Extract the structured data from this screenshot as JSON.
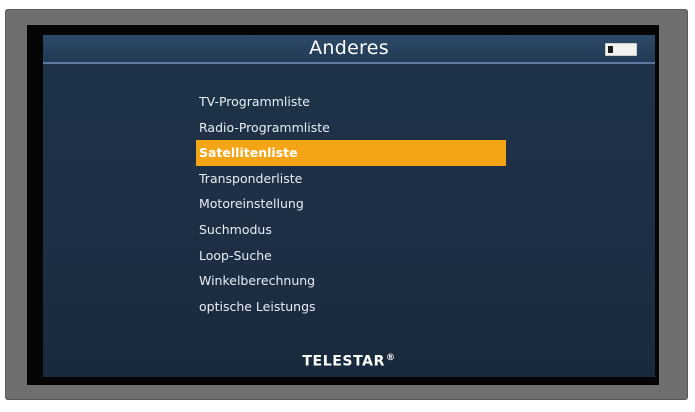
{
  "screen": {
    "title": "Anderes",
    "battery_icon": "battery-icon"
  },
  "menu": {
    "selected_index": 2,
    "items": [
      {
        "label": "TV-Programmliste"
      },
      {
        "label": "Radio-Programmliste"
      },
      {
        "label": "Satellitenliste"
      },
      {
        "label": "Transponderliste"
      },
      {
        "label": "Motoreinstellung"
      },
      {
        "label": "Suchmodus"
      },
      {
        "label": "Loop-Suche"
      },
      {
        "label": "Winkelberechnung"
      },
      {
        "label": "optische Leistungs"
      }
    ]
  },
  "brand": {
    "name": "TELESTAR",
    "mark": "®"
  },
  "colors": {
    "highlight": "#f4a515",
    "screen_background": "#1f3349",
    "frame": "#6f6f6f"
  }
}
